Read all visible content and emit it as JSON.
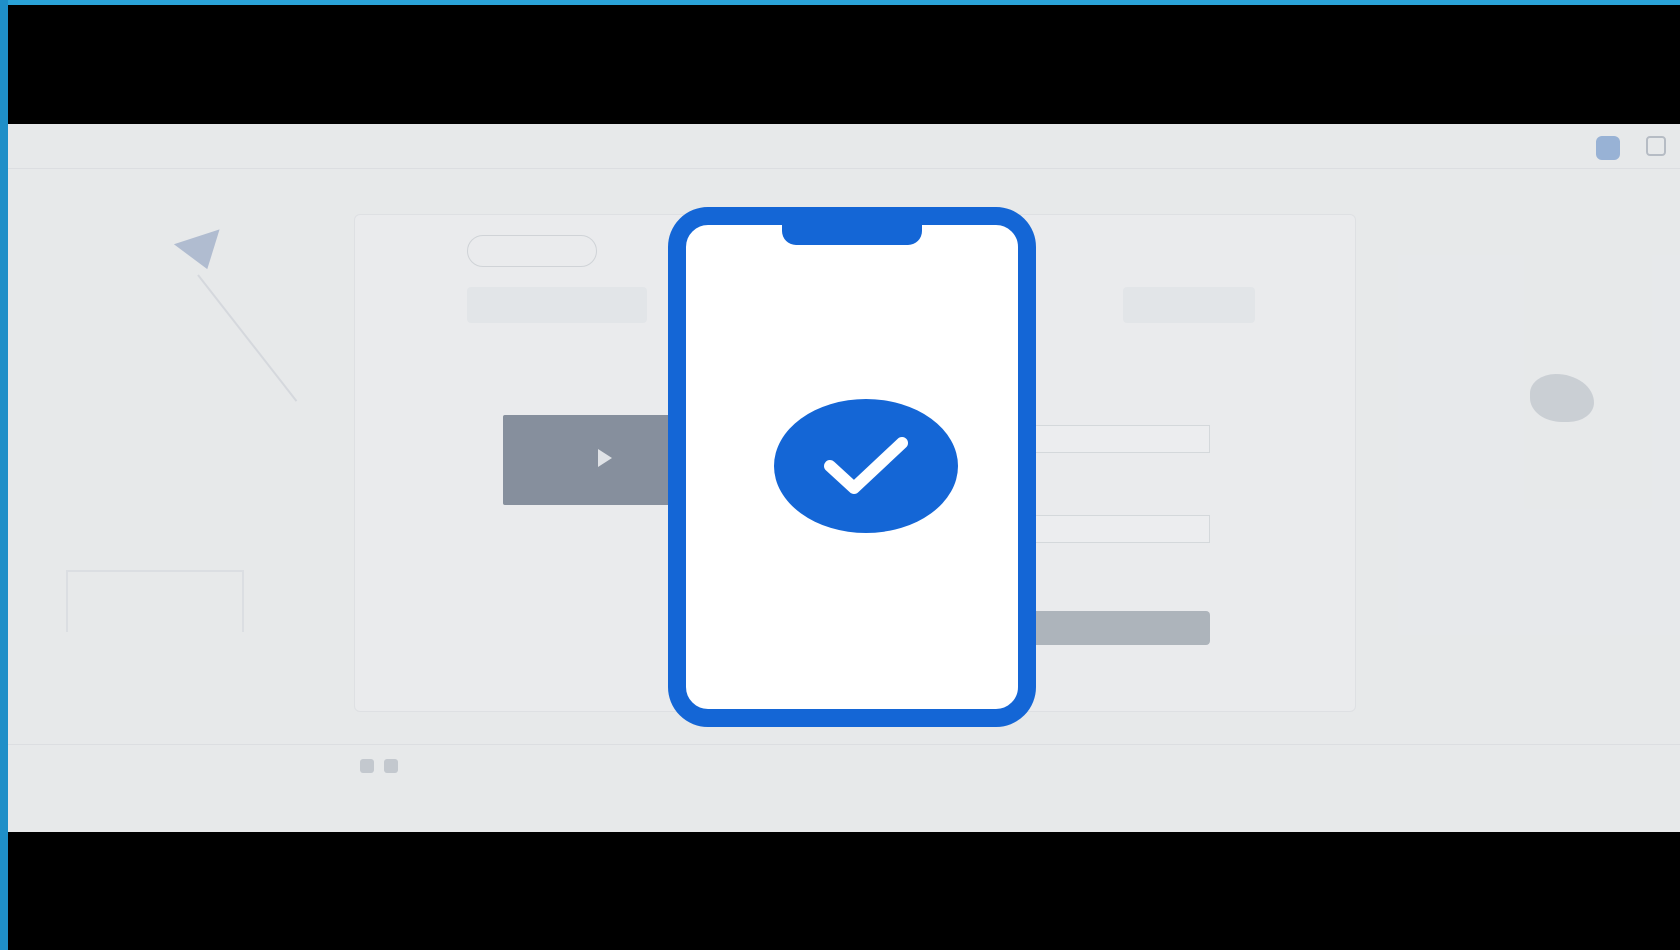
{
  "colors": {
    "accent": "#1466d6",
    "frame": "#2aa3d8",
    "background": "#000000"
  },
  "background_page": {
    "topbar": {
      "brand_icon": "shield-icon",
      "menu_icon": "grid-icon"
    },
    "card": {
      "share_icon": "share-icon",
      "play_icon": "play-icon"
    },
    "footer": {
      "social_icons": [
        "facebook-icon",
        "youtube-icon"
      ],
      "lock_icon": "lock-icon"
    }
  },
  "overlay": {
    "check_icon": "check-icon"
  }
}
